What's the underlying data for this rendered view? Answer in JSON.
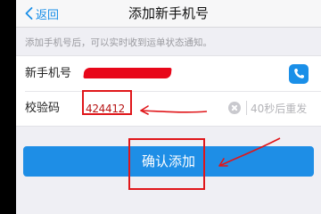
{
  "nav": {
    "back_label": "返回",
    "title": "添加新手机号"
  },
  "hint": "添加手机号后，可以实时收到运单状态通知。",
  "form": {
    "phone_label": "新手机号",
    "phone_value_redacted": true,
    "code_label": "校验码",
    "code_value": "424412",
    "resend_label": "40秒后重发"
  },
  "confirm_label": "确认添加",
  "colors": {
    "accent": "#1a8fe8",
    "annotation": "#e0161a"
  }
}
